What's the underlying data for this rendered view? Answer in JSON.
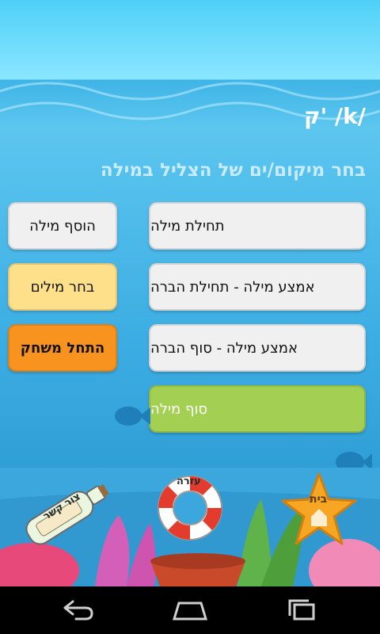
{
  "header": {
    "title": "ק' /k/"
  },
  "instruction": "בחר מיקום/ים של הצליל במילה",
  "positions": [
    {
      "label": "תחילת מילה",
      "selected": false
    },
    {
      "label": "אמצע מילה - תחילת הברה",
      "selected": false
    },
    {
      "label": "אמצע מילה - סוף הברה",
      "selected": false
    },
    {
      "label": "סוף מילה",
      "selected": true
    }
  ],
  "actions": {
    "add_word": "הוסף מילה",
    "choose_words": "בחר מילים",
    "start_game": "התחל משחק"
  },
  "bottom": {
    "contact": "צור קשר",
    "help": "עזרה",
    "home": "בית"
  },
  "icons": [
    "bottle-message-icon",
    "lifebuoy-icon",
    "starfish-home-icon",
    "back-icon",
    "home-icon",
    "recent-apps-icon"
  ],
  "colors": {
    "selected": "#a3cf52",
    "start": "#f7931e",
    "choose": "#ffe08a"
  }
}
